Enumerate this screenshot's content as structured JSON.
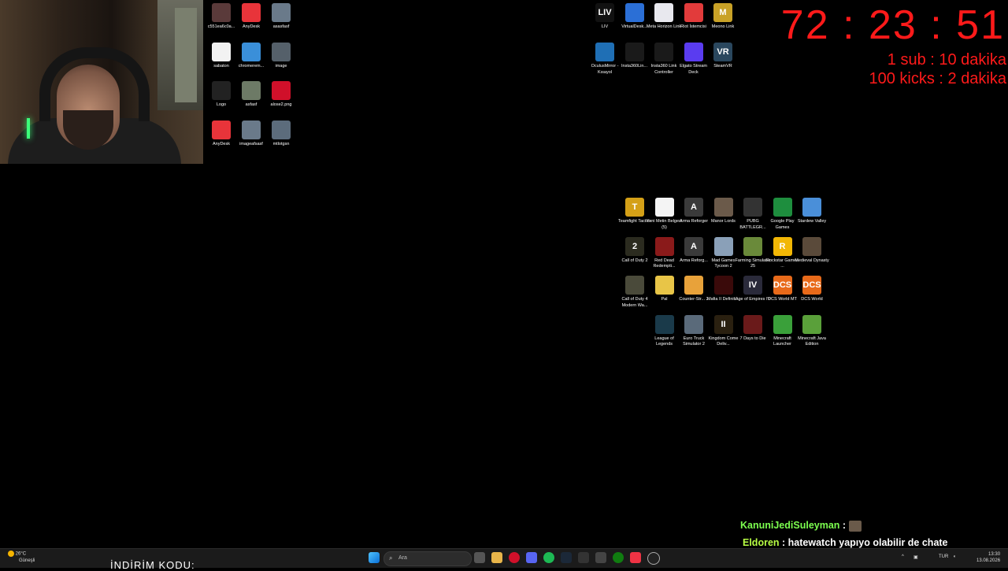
{
  "timer": {
    "value": "72 : 23 : 51",
    "rule1": "1 sub : 10 dakika",
    "rule2": "100 kicks : 2 dakika"
  },
  "left_icons": [
    {
      "label": "c551ea6c0a...",
      "icon": "image-thumb-icon",
      "color": "#5a3a3a"
    },
    {
      "label": "AnyDesk",
      "icon": "anydesk-icon",
      "color": "#e8343a"
    },
    {
      "label": "asasfasf",
      "icon": "image-thumb-icon",
      "color": "#6a7a8a"
    },
    {
      "label": "sabaton",
      "icon": "file-icon",
      "color": "#f2f2f2"
    },
    {
      "label": "chromerem...",
      "icon": "chrome-remote-icon",
      "color": "#3a8fd9"
    },
    {
      "label": "image",
      "icon": "image-thumb-icon",
      "color": "#55606a"
    },
    {
      "label": "Logo",
      "icon": "logo-image-icon",
      "color": "#222222"
    },
    {
      "label": "asfasf",
      "icon": "image-thumb-icon",
      "color": "#6d7a66"
    },
    {
      "label": "alose2.png",
      "icon": "opera-icon",
      "color": "#d0102a"
    },
    {
      "label": "AnyDesk",
      "icon": "anydesk-icon",
      "color": "#e8343a"
    },
    {
      "label": "imageafsasf",
      "icon": "image-thumb-icon",
      "color": "#6a7a8a"
    },
    {
      "label": "mtlotgsn",
      "icon": "image-thumb-icon",
      "color": "#5c6c7c"
    }
  ],
  "top_icons": [
    {
      "label": "LIV",
      "icon": "liv-icon",
      "color": "#111111",
      "text": "LIV"
    },
    {
      "label": "VirtualDesk...",
      "icon": "virtual-desktop-icon",
      "color": "#2b6fd6",
      "text": ""
    },
    {
      "label": "Meta Horizon Link",
      "icon": "meta-horizon-icon",
      "color": "#e8e8ee",
      "text": ""
    },
    {
      "label": "Riot İstemcisi",
      "icon": "riot-icon",
      "color": "#e23b3b",
      "text": ""
    },
    {
      "label": "Meono Link",
      "icon": "meono-link-icon",
      "color": "#c9a227",
      "text": "M"
    },
    {
      "label": "OculusMirror - Kısayol",
      "icon": "oculus-mirror-icon",
      "color": "#1f6fb5",
      "text": ""
    },
    {
      "label": "Insta360Lin...",
      "icon": "insta360-icon",
      "color": "#1a1a1a",
      "text": ""
    },
    {
      "label": "Insta360 Link Controller",
      "icon": "insta360-controller-icon",
      "color": "#1a1a1a",
      "text": ""
    },
    {
      "label": "Elgato Stream Deck",
      "icon": "stream-deck-icon",
      "color": "#5a3cf0",
      "text": ""
    },
    {
      "label": "SteamVR",
      "icon": "steamvr-icon",
      "color": "#2a475e",
      "text": "VR"
    }
  ],
  "game_icons": [
    {
      "label": "Teamfight Tactics",
      "icon": "tft-icon",
      "color": "#d4a017",
      "text": "T"
    },
    {
      "label": "Yeni Metin Belgesi (5)",
      "icon": "text-file-icon",
      "color": "#f4f4f4",
      "text": ""
    },
    {
      "label": "Arma Reforger",
      "icon": "arma-icon",
      "color": "#3a3a3a",
      "text": "A"
    },
    {
      "label": "Manor Lords",
      "icon": "manor-lords-icon",
      "color": "#6b5a4a",
      "text": ""
    },
    {
      "label": "PUBG BATTLEGR...",
      "icon": "pubg-icon",
      "color": "#333333",
      "text": ""
    },
    {
      "label": "Google Play Games",
      "icon": "google-play-games-icon",
      "color": "#1e8e3e",
      "text": ""
    },
    {
      "label": "Stardew Valley",
      "icon": "stardew-icon",
      "color": "#4a8fd9",
      "text": ""
    },
    {
      "label": "Call of Duty 2",
      "icon": "cod2-icon",
      "color": "#2b2b1f",
      "text": "2"
    },
    {
      "label": "Red Dead Redempti...",
      "icon": "rdr-icon",
      "color": "#8a1a1a",
      "text": ""
    },
    {
      "label": "Arma Reforg...",
      "icon": "arma-icon",
      "color": "#3a3a3a",
      "text": "A"
    },
    {
      "label": "Mad Games Tycoon 2",
      "icon": "mad-games-icon",
      "color": "#8aa0b8",
      "text": ""
    },
    {
      "label": "Farming Simulator 25",
      "icon": "farming-sim-icon",
      "color": "#6a8a3a",
      "text": ""
    },
    {
      "label": "Rockstar Games ...",
      "icon": "rockstar-icon",
      "color": "#f2b705",
      "text": "R"
    },
    {
      "label": "Medieval Dynasty",
      "icon": "medieval-dynasty-icon",
      "color": "#5a4a3a",
      "text": ""
    },
    {
      "label": "Call of Duty 4 Modern Wa...",
      "icon": "cod4-icon",
      "color": "#4a4a3a",
      "text": ""
    },
    {
      "label": "Pal",
      "icon": "palworld-icon",
      "color": "#e8c547",
      "text": ""
    },
    {
      "label": "Counter-Str... 2",
      "icon": "cs2-icon",
      "color": "#e8a23a",
      "text": ""
    },
    {
      "label": "Mafia II Definiti...",
      "icon": "mafia-icon",
      "color": "#3a0a0a",
      "text": ""
    },
    {
      "label": "Age of Empires IV",
      "icon": "aoe4-icon",
      "color": "#2a2a3a",
      "text": "IV"
    },
    {
      "label": "DCS World MT",
      "icon": "dcs-icon",
      "color": "#e86a1a",
      "text": "DCS"
    },
    {
      "label": "DCS World",
      "icon": "dcs-icon",
      "color": "#e86a1a",
      "text": "DCS"
    },
    {
      "label": "",
      "icon": "",
      "color": "",
      "text": ""
    },
    {
      "label": "League of Legends",
      "icon": "lol-icon",
      "color": "#1a3a4a",
      "text": ""
    },
    {
      "label": "Euro Truck Simulator 2",
      "icon": "ets2-icon",
      "color": "#5a6a7a",
      "text": ""
    },
    {
      "label": "Kingdom Come Deliv...",
      "icon": "kcd-icon",
      "color": "#2a2010",
      "text": "II"
    },
    {
      "label": "7 Days to Die",
      "icon": "7dtd-icon",
      "color": "#6a1a1a",
      "text": ""
    },
    {
      "label": "Minecraft Launcher",
      "icon": "minecraft-icon",
      "color": "#3aa03a",
      "text": ""
    },
    {
      "label": "Minecraft Java Edition",
      "icon": "minecraft-java-icon",
      "color": "#5aa03a",
      "text": ""
    }
  ],
  "chat": [
    {
      "user": "KanuniJediSuleyman",
      "message": ""
    },
    {
      "user": "Eldoren",
      "message": "hatewatch yapıyo olabilir de chate bişiler yazmadan ban yemezsin herhalde"
    }
  ],
  "taskbar": {
    "weather_temp": "26°C",
    "weather_desc": "Güneşli",
    "search_placeholder": "Ara",
    "lang": "TUR",
    "time": "13:30",
    "date": "13.08.2026",
    "promo": "İNDİRİM KODU:"
  }
}
